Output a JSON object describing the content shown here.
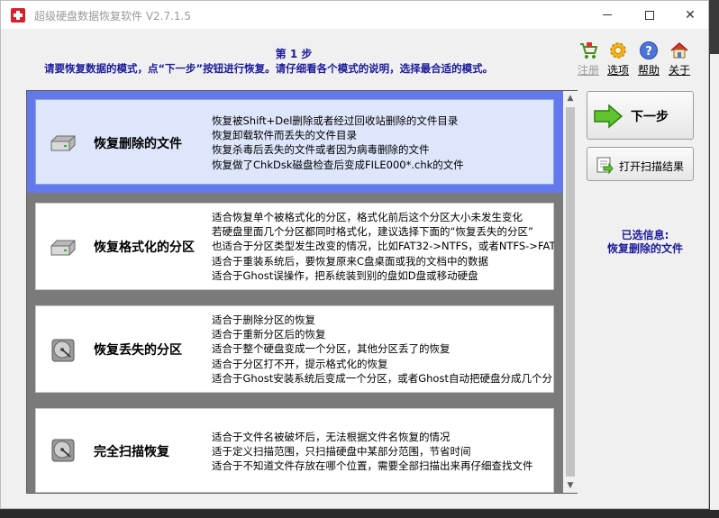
{
  "window": {
    "title": "超级硬盘数据恢复软件 V2.7.1.5"
  },
  "header": {
    "step_title": "第 1 步",
    "step_desc": "请要恢复数据的模式，点“下一步”按钮进行恢复。请仔细看各个模式的说明，选择最合适的模式。"
  },
  "toolbar": {
    "register": "注册",
    "options": "选项",
    "help": "帮助",
    "about": "关于"
  },
  "modes": [
    {
      "title": "恢复删除的文件",
      "icon": "hard-disk-icon",
      "lines": [
        "恢复被Shift+Del删除或者经过回收站删除的文件目录",
        "恢复卸载软件而丢失的文件目录",
        "恢复杀毒后丢失的文件或者因为病毒删除的文件",
        "恢复做了ChkDsk磁盘检查后变成FILE000*.chk的文件"
      ]
    },
    {
      "title": "恢复格式化的分区",
      "icon": "hard-disk-icon",
      "lines": [
        "适合恢复单个被格式化的分区，格式化前后这个分区大小未发生变化",
        "若硬盘里面几个分区都同时格式化，建议选择下面的“恢复丢失的分区”",
        "也适合于分区类型发生改变的情况，比如FAT32->NTFS，或者NTFS->FAT3",
        "适合于重装系统后，要恢复原来C盘桌面或我的文档中的数据",
        "适合于Ghost误操作，把系统装到别的盘如D盘或移动硬盘"
      ]
    },
    {
      "title": "恢复丢失的分区",
      "icon": "disk-platter-icon",
      "lines": [
        "适合于删除分区的恢复",
        "适合于重新分区后的恢复",
        "适合于整个硬盘变成一个分区，其他分区丢了的恢复",
        "适合于分区打不开，提示格式化的恢复",
        "适合于Ghost安装系统后变成一个分区，或者Ghost自动把硬盘分成几个分"
      ]
    },
    {
      "title": "完全扫描恢复",
      "icon": "disk-platter-icon",
      "lines": [
        "适合于文件名被破坏后，无法根据文件名恢复的情况",
        "适于定义扫描范围，只扫描硬盘中某部分范围，节省时间",
        "适合于不知道文件存放在哪个位置，需要全部扫描出来再仔细查找文件"
      ]
    }
  ],
  "buttons": {
    "next": "下一步",
    "open_scan": "打开扫描结果"
  },
  "selection": {
    "label": "已选信息:",
    "value": "恢复删除的文件"
  },
  "colors": {
    "accent_blue": "#1c1c9a",
    "selected_frame": "#6378ec",
    "list_bg": "#7a7a7a"
  }
}
